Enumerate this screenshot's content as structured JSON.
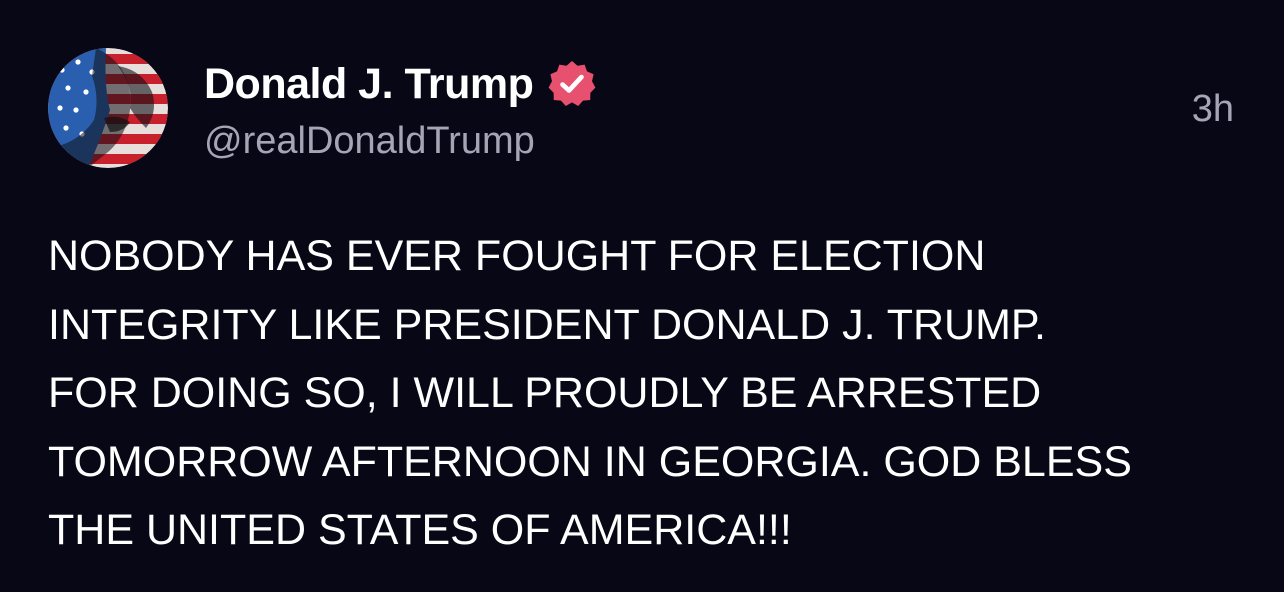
{
  "post": {
    "author": {
      "display_name": "Donald J. Trump",
      "handle": "@realDonaldTrump",
      "verified_icon": "verified-badge-icon",
      "avatar_icon": "flag-portrait-avatar"
    },
    "timestamp": "3h",
    "body_lines": [
      "NOBODY HAS EVER FOUGHT FOR ELECTION",
      "INTEGRITY LIKE PRESIDENT DONALD J. TRUMP.",
      "FOR DOING SO, I WILL PROUDLY BE ARRESTED",
      "TOMORROW AFTERNOON IN GEORGIA. GOD BLESS",
      "THE UNITED STATES OF AMERICA!!!"
    ]
  },
  "colors": {
    "background": "#080716",
    "text_primary": "#ffffff",
    "text_secondary": "#a6a5b6",
    "verified_badge": "#e7516f"
  }
}
